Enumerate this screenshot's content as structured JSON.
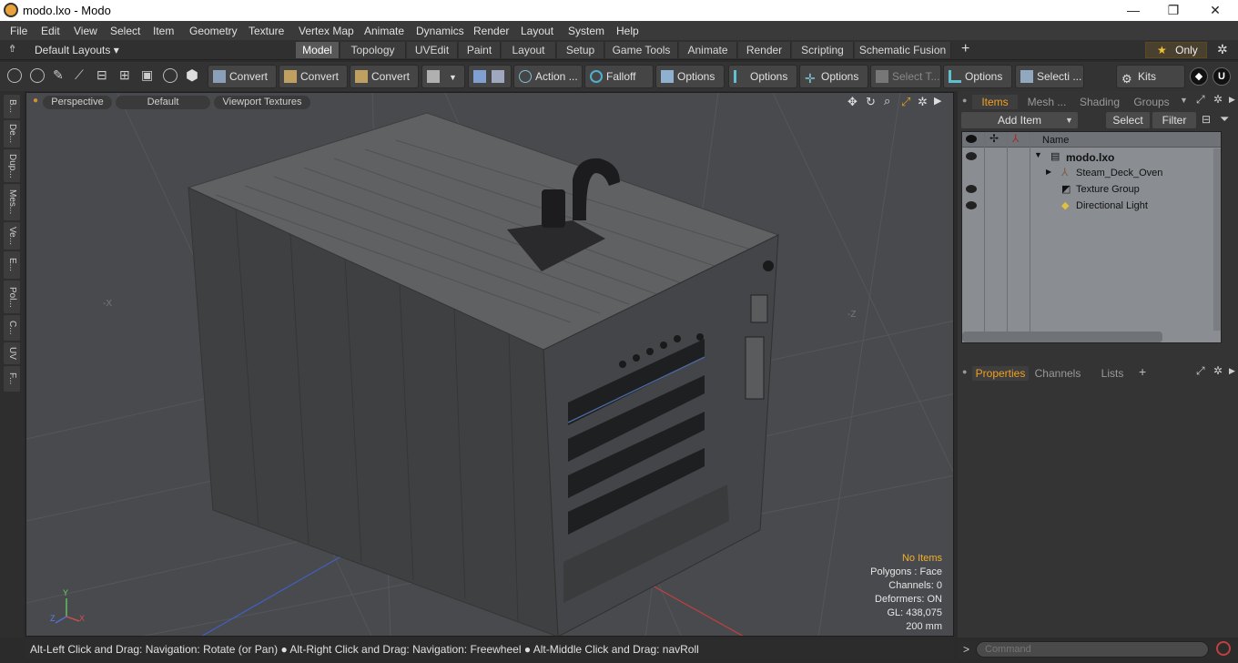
{
  "window": {
    "title": "modo.lxo - Modo",
    "minimize": "—",
    "restore": "❐",
    "close": "✕"
  },
  "menu": [
    "File",
    "Edit",
    "View",
    "Select",
    "Item",
    "Geometry",
    "Texture",
    "Vertex Map",
    "Animate",
    "Dynamics",
    "Render",
    "Layout",
    "System",
    "Help"
  ],
  "layouts_dropdown": "Default Layouts ▾",
  "layout_tabs": [
    "Model",
    "Topology",
    "UVEdit",
    "Paint",
    "Layout",
    "Setup",
    "Game Tools",
    "Animate",
    "Render",
    "Scripting",
    "Schematic Fusion"
  ],
  "active_layout_tab": "Model",
  "add_tab": "+",
  "only_label": "Only",
  "toolbar": {
    "convert1": "Convert",
    "convert2": "Convert",
    "convert3": "Convert",
    "action": "Action",
    "action_more": "...",
    "falloff": "Falloff",
    "options1": "Options",
    "options2": "Options",
    "options3": "Options",
    "select_t": "Select T...",
    "options4": "Options",
    "selecti": "Selecti ...",
    "kits": "Kits"
  },
  "left_tabs": [
    "B...",
    "De...",
    "Dup...",
    "Mes...",
    "Ve...",
    "E...",
    "Pol...",
    "C...",
    "UV",
    "F..."
  ],
  "viewport": {
    "perspective": "Perspective",
    "default": "Default",
    "textures": "Viewport Textures",
    "axis_neg_x": "-X",
    "axis_neg_z": "-Z",
    "info": {
      "no_items": "No Items",
      "polygons": "Polygons : Face",
      "channels": "Channels: 0",
      "deformers": "Deformers: ON",
      "gl": "GL: 438,075",
      "scale": "200 mm"
    }
  },
  "status": "Alt-Left Click and Drag: Navigation: Rotate (or Pan) ● Alt-Right Click and Drag: Navigation: Freewheel ● Alt-Middle Click and Drag: navRoll",
  "items_panel": {
    "tabs": [
      "Items",
      "Mesh ...",
      "Shading",
      "Groups"
    ],
    "add_item": "Add Item",
    "select": "Select",
    "filter": "Filter",
    "name_col": "Name",
    "rows": [
      {
        "label": "modo.lxo",
        "bold": true
      },
      {
        "label": "Steam_Deck_Oven"
      },
      {
        "label": "Texture Group"
      },
      {
        "label": "Directional Light"
      }
    ]
  },
  "props_panel": {
    "tabs": [
      "Properties",
      "Channels",
      "Lists"
    ],
    "add": "+"
  },
  "command": {
    "prompt": ">",
    "placeholder": "Command"
  }
}
